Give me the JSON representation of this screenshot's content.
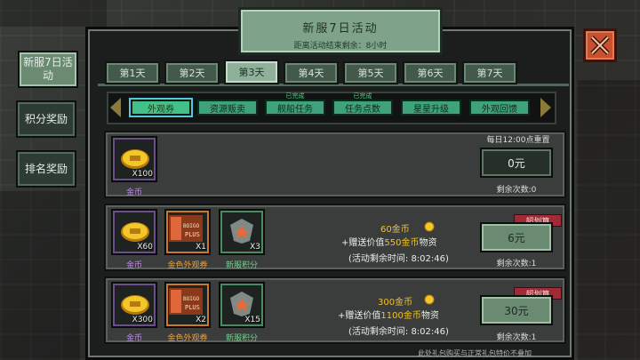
{
  "title_banner": {
    "title": "新服7日活动",
    "subtitle": "距离活动结束剩余：8小时"
  },
  "side_menu": [
    {
      "label": "新服7日活动",
      "active": true
    },
    {
      "label": "积分奖励",
      "active": false
    },
    {
      "label": "排名奖励",
      "active": false
    }
  ],
  "day_tabs": [
    "第1天",
    "第2天",
    "第3天",
    "第4天",
    "第5天",
    "第6天",
    "第7天"
  ],
  "active_day": 2,
  "categories": [
    {
      "label": "外观券",
      "hint": ""
    },
    {
      "label": "资源贩卖",
      "hint": ""
    },
    {
      "label": "舰船任务",
      "hint": "已完成"
    },
    {
      "label": "任务点数",
      "hint": "已完成"
    },
    {
      "label": "星星升级",
      "hint": ""
    },
    {
      "label": "外观回馈",
      "hint": ""
    }
  ],
  "rows": [
    {
      "items": [
        {
          "name": "金币",
          "qty": "X100",
          "kind": "coin"
        }
      ],
      "reset_text": "每日12:00点重置",
      "price": "0元",
      "remaining": "剩余次数:0"
    },
    {
      "items": [
        {
          "name": "金币",
          "qty": "X60",
          "kind": "coin"
        },
        {
          "name": "金色外观券",
          "qty": "X1",
          "kind": "ticket"
        },
        {
          "name": "新服积分",
          "qty": "X3",
          "kind": "badge"
        }
      ],
      "offer_main": "60金币",
      "offer_gift_prefix": "+赠送价值",
      "offer_gift_amount": "550金币",
      "offer_gift_suffix": "物资",
      "countdown": "(活动剩余时间: 8:02:46)",
      "ribbon": "超划算",
      "price": "6元",
      "remaining": "剩余次数:1"
    },
    {
      "items": [
        {
          "name": "金币",
          "qty": "X300",
          "kind": "coin"
        },
        {
          "name": "金色外观券",
          "qty": "X2",
          "kind": "ticket"
        },
        {
          "name": "新服积分",
          "qty": "X15",
          "kind": "badge"
        }
      ],
      "offer_main": "300金币",
      "offer_gift_prefix": "+赠送价值",
      "offer_gift_amount": "1100金币",
      "offer_gift_suffix": "物资",
      "countdown": "(活动剩余时间: 8:02:46)",
      "ribbon": "超划算",
      "price": "30元",
      "remaining": "剩余次数:1"
    }
  ],
  "ticket_text": [
    "BOIGO",
    "PLUS"
  ],
  "footer_note": "此处礼包购买与正常礼包特价不叠加",
  "colors": {
    "accent_green": "#43c08a",
    "ribbon_red": "#a02a36",
    "gold": "#f0c22a",
    "close_red": "#c9502e"
  }
}
